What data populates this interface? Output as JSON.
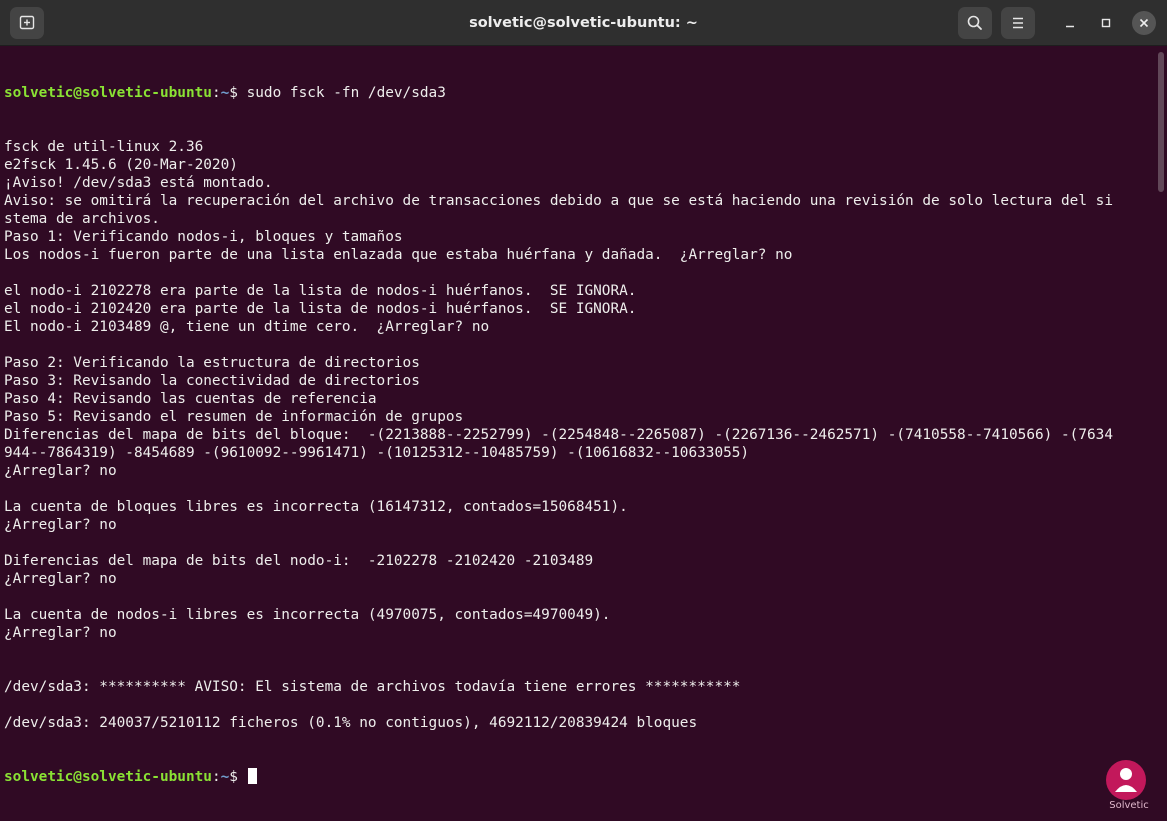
{
  "window": {
    "title": "solvetic@solvetic-ubuntu: ~"
  },
  "colors": {
    "background": "#300a24",
    "titlebar": "#2f2f2f",
    "prompt_user": "#8ae234",
    "prompt_path": "#729fcf",
    "text": "#eeeeec"
  },
  "titlebar": {
    "left_icon": "new-tab-icon",
    "right_icons": [
      "search-icon",
      "hamburger-menu-icon",
      "minimize-icon",
      "maximize-icon",
      "close-icon"
    ]
  },
  "terminal": {
    "prompt_user": "solvetic@solvetic-ubuntu",
    "prompt_sep": ":",
    "prompt_path": "~",
    "prompt_symbol": "$ ",
    "command": "sudo fsck -fn /dev/sda3",
    "output": [
      "fsck de util-linux 2.36",
      "e2fsck 1.45.6 (20-Mar-2020)",
      "¡Aviso! /dev/sda3 está montado.",
      "Aviso: se omitirá la recuperación del archivo de transacciones debido a que se está haciendo una revisión de solo lectura del si",
      "stema de archivos.",
      "Paso 1: Verificando nodos-i, bloques y tamaños",
      "Los nodos-i fueron parte de una lista enlazada que estaba huérfana y dañada.  ¿Arreglar? no",
      "",
      "el nodo-i 2102278 era parte de la lista de nodos-i huérfanos.  SE IGNORA.",
      "el nodo-i 2102420 era parte de la lista de nodos-i huérfanos.  SE IGNORA.",
      "El nodo-i 2103489 @, tiene un dtime cero.  ¿Arreglar? no",
      "",
      "Paso 2: Verificando la estructura de directorios",
      "Paso 3: Revisando la conectividad de directorios",
      "Paso 4: Revisando las cuentas de referencia",
      "Paso 5: Revisando el resumen de información de grupos",
      "Diferencias del mapa de bits del bloque:  -(2213888--2252799) -(2254848--2265087) -(2267136--2462571) -(7410558--7410566) -(7634",
      "944--7864319) -8454689 -(9610092--9961471) -(10125312--10485759) -(10616832--10633055)",
      "¿Arreglar? no",
      "",
      "La cuenta de bloques libres es incorrecta (16147312, contados=15068451).",
      "¿Arreglar? no",
      "",
      "Diferencias del mapa de bits del nodo-i:  -2102278 -2102420 -2103489",
      "¿Arreglar? no",
      "",
      "La cuenta de nodos-i libres es incorrecta (4970075, contados=4970049).",
      "¿Arreglar? no",
      "",
      "",
      "/dev/sda3: ********** AVISO: El sistema de archivos todavía tiene errores ***********",
      "",
      "/dev/sda3: 240037/5210112 ficheros (0.1% no contiguos), 4692112/20839424 bloques"
    ]
  },
  "watermark": {
    "icon": "solvetic-logo-icon",
    "text": "Solvetic"
  }
}
